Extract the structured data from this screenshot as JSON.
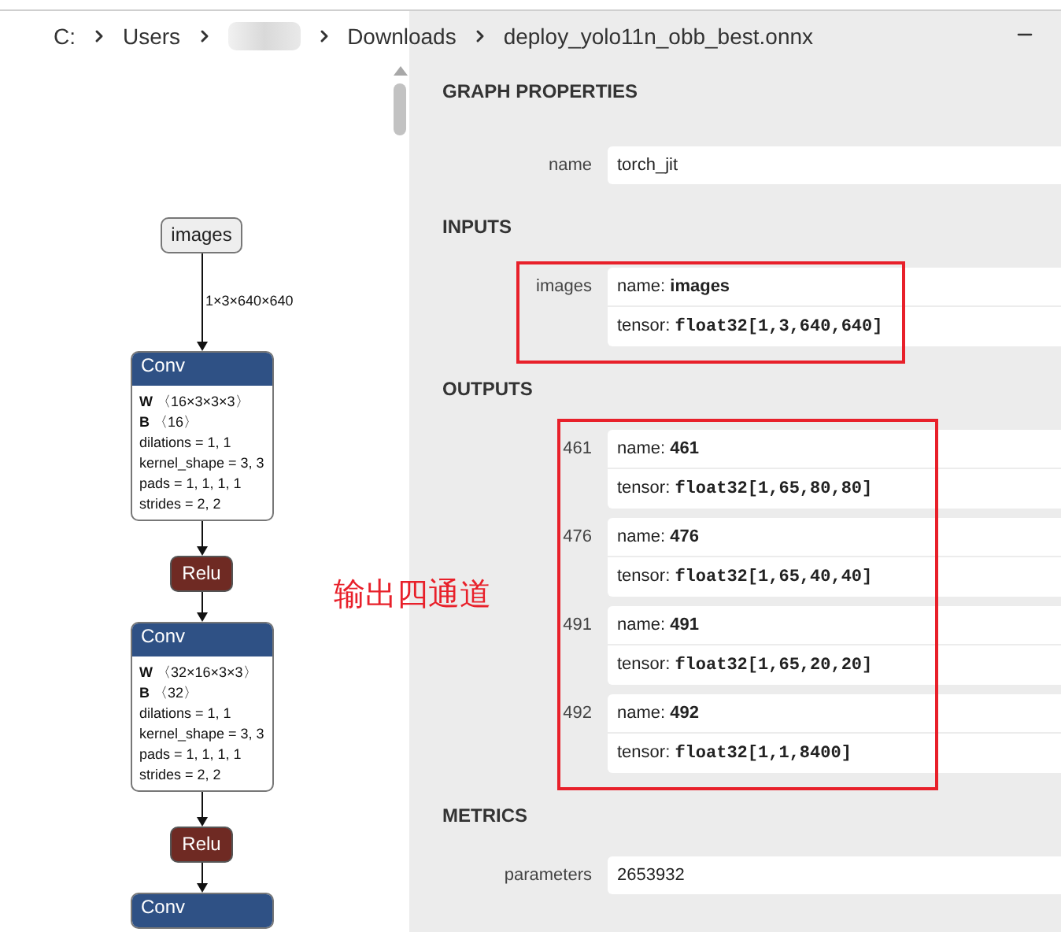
{
  "breadcrumb": [
    {
      "kind": "folder",
      "label": "C:"
    },
    {
      "kind": "folder",
      "label": "Users"
    },
    {
      "kind": "redacted"
    },
    {
      "kind": "folder",
      "label": "Downloads"
    },
    {
      "kind": "file",
      "label": "deploy_yolo11n_obb_best.onnx"
    }
  ],
  "graph": {
    "nodes": [
      {
        "kind": "input",
        "title": "images",
        "edge_label": "1×3×640×640"
      },
      {
        "kind": "conv",
        "title": "Conv",
        "lines": [
          "**W** 〈16×3×3×3〉",
          "**B** 〈16〉",
          "dilations = 1, 1",
          "kernel_shape = 3, 3",
          "pads = 1, 1, 1, 1",
          "strides = 2, 2"
        ]
      },
      {
        "kind": "relu",
        "title": "Relu"
      },
      {
        "kind": "conv",
        "title": "Conv",
        "lines": [
          "**W** 〈32×16×3×3〉",
          "**B** 〈32〉",
          "dilations = 1, 1",
          "kernel_shape = 3, 3",
          "pads = 1, 1, 1, 1",
          "strides = 2, 2"
        ]
      },
      {
        "kind": "relu",
        "title": "Relu"
      },
      {
        "kind": "conv",
        "title": "Conv"
      }
    ]
  },
  "sections": [
    {
      "title": "GRAPH PROPERTIES",
      "rows": [
        {
          "kind": "simple",
          "label": "name",
          "value": "torch_jit"
        }
      ]
    },
    {
      "title": "INPUTS",
      "highlighted": true,
      "rows": [
        {
          "kind": "tensor",
          "label": "images",
          "name_prefix": "name:",
          "name": "images",
          "tensor_prefix": "tensor:",
          "tensor": "float32[1,3,640,640]"
        }
      ]
    },
    {
      "title": "OUTPUTS",
      "highlighted": true,
      "note": "输出四通道",
      "rows": [
        {
          "kind": "tensor",
          "label": "461",
          "name_prefix": "name:",
          "name": "461",
          "tensor_prefix": "tensor:",
          "tensor": "float32[1,65,80,80]"
        },
        {
          "kind": "tensor",
          "label": "476",
          "name_prefix": "name:",
          "name": "476",
          "tensor_prefix": "tensor:",
          "tensor": "float32[1,65,40,40]"
        },
        {
          "kind": "tensor",
          "label": "491",
          "name_prefix": "name:",
          "name": "491",
          "tensor_prefix": "tensor:",
          "tensor": "float32[1,65,20,20]"
        },
        {
          "kind": "tensor",
          "label": "492",
          "name_prefix": "name:",
          "name": "492",
          "tensor_prefix": "tensor:",
          "tensor": "float32[1,1,8400]"
        }
      ]
    },
    {
      "title": "METRICS",
      "rows": [
        {
          "kind": "simple",
          "label": "parameters",
          "value": "2653932"
        }
      ]
    }
  ]
}
